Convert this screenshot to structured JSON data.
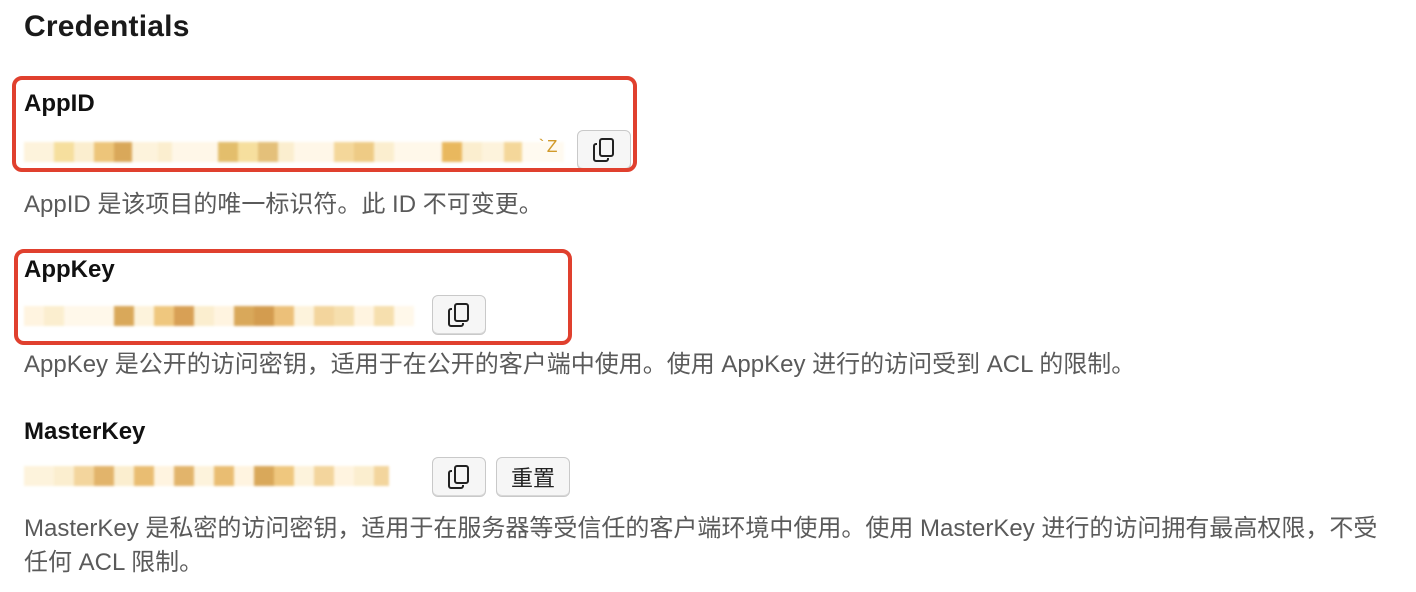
{
  "section": {
    "title": "Credentials"
  },
  "appid": {
    "label": "AppID",
    "masked_suffix": "`Z",
    "copy_icon": "copy-icon",
    "description": "AppID 是该项目的唯一标识符。此 ID 不可变更。"
  },
  "appkey": {
    "label": "AppKey",
    "copy_icon": "copy-icon",
    "description": "AppKey 是公开的访问密钥，适用于在公开的客户端中使用。使用 AppKey 进行的访问受到 ACL 的限制。"
  },
  "masterkey": {
    "label": "MasterKey",
    "copy_icon": "copy-icon",
    "reset_label": "重置",
    "description": "MasterKey 是私密的访问密钥，适用于在服务器等受信任的客户端环境中使用。使用 MasterKey 进行的访问拥有最高权限，不受任何 ACL 限制。"
  },
  "colors": {
    "highlight": "#e0402e",
    "mask_light": "#fbeecf",
    "mask_mid": "#efc77e",
    "mask_dark": "#d9a85a"
  }
}
